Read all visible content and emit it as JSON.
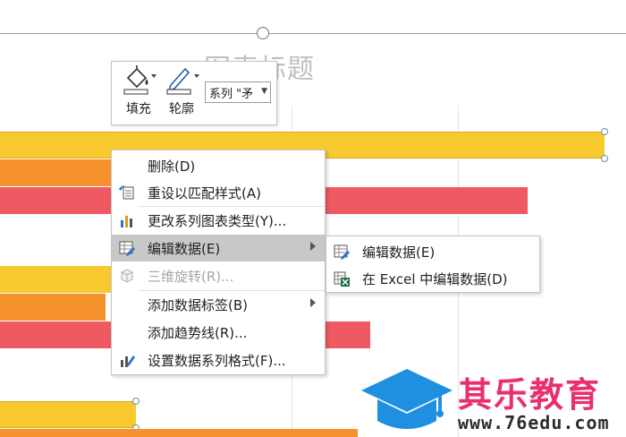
{
  "chart": {
    "title": "图表标题"
  },
  "mini_toolbar": {
    "fill_label": "填充",
    "outline_label": "轮廓",
    "series_dropdown": "系列 \"矛"
  },
  "context_menu": {
    "items": [
      {
        "label": "删除(D)",
        "icon": "delete-icon",
        "enabled": true
      },
      {
        "label": "重设以匹配样式(A)",
        "icon": "reset-style-icon",
        "enabled": true
      },
      {
        "label": "更改系列图表类型(Y)...",
        "icon": "bar-chart-icon",
        "enabled": true
      },
      {
        "label": "编辑数据(E)",
        "icon": "edit-data-icon",
        "enabled": true,
        "submenu": true,
        "highlighted": true
      },
      {
        "label": "三维旋转(R)...",
        "icon": "rotate-3d-icon",
        "enabled": false
      },
      {
        "label": "添加数据标签(B)",
        "icon": "",
        "enabled": true,
        "submenu": true
      },
      {
        "label": "添加趋势线(R)...",
        "icon": "",
        "enabled": true
      },
      {
        "label": "设置数据系列格式(F)...",
        "icon": "format-series-icon",
        "enabled": true
      }
    ]
  },
  "submenu": {
    "items": [
      {
        "label": "编辑数据(E)",
        "icon": "edit-data-icon"
      },
      {
        "label": "在 Excel 中编辑数据(D)",
        "icon": "excel-icon"
      }
    ]
  },
  "watermark": {
    "brand": "其乐教育",
    "url": "www.76edu.com"
  },
  "colors": {
    "yellow": "#f9c930",
    "orange": "#f6922e",
    "red": "#ef5a62",
    "highlight": "#c8c8c8",
    "logo_blue": "#1f8fe0",
    "logo_pink": "#e8306f"
  }
}
